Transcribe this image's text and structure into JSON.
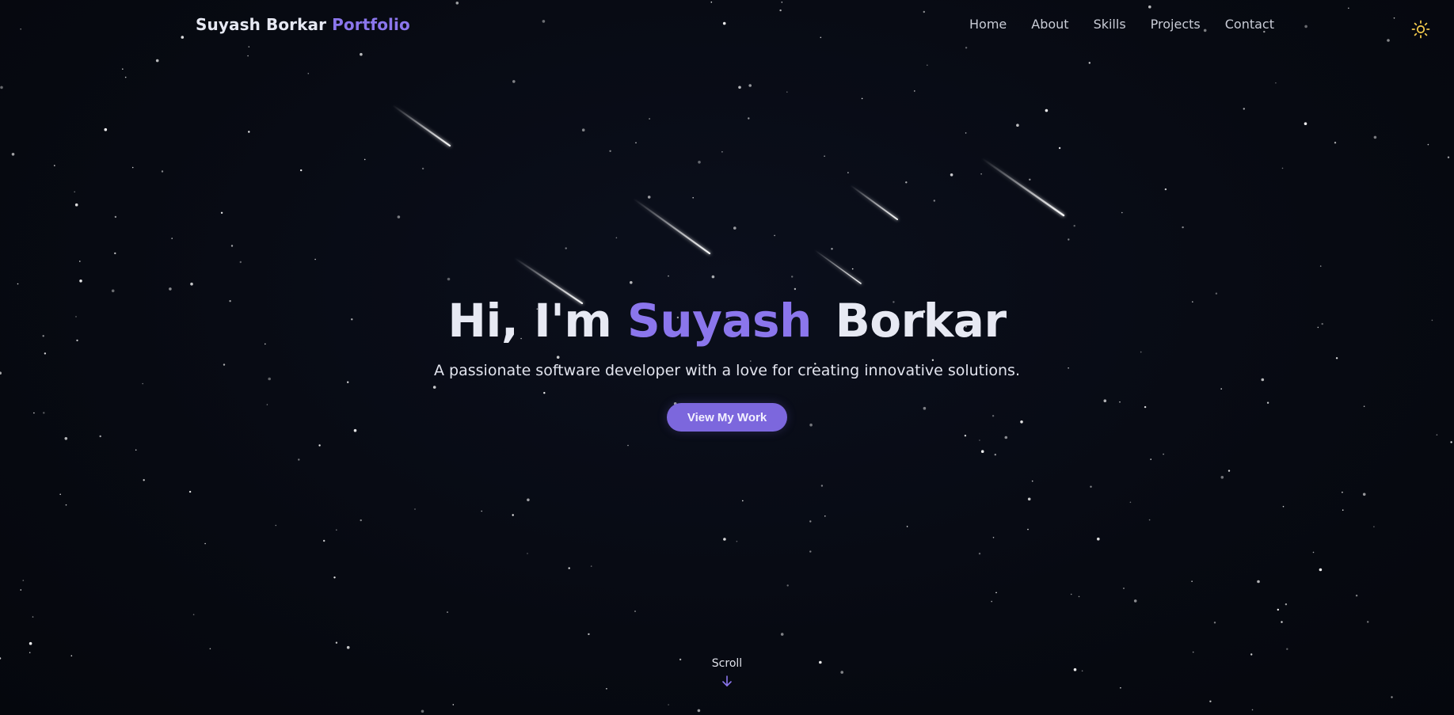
{
  "brand": {
    "name": "Suyash Borkar",
    "accent": "Portfolio"
  },
  "nav": {
    "items": [
      {
        "label": "Home"
      },
      {
        "label": "About"
      },
      {
        "label": "Skills"
      },
      {
        "label": "Projects"
      },
      {
        "label": "Contact"
      }
    ]
  },
  "theme_toggle": {
    "icon": "sun-icon"
  },
  "hero": {
    "greeting": "Hi, I'm",
    "first_name": "Suyash",
    "last_name": "Borkar",
    "tagline": "A passionate software developer with a love for creating innovative solutions.",
    "cta_label": "View My Work"
  },
  "scroll": {
    "label": "Scroll",
    "icon": "arrow-down-icon"
  },
  "colors": {
    "background": "#070a12",
    "accent": "#8b76ec",
    "button": "#7c67dd",
    "sun": "#f2c94c"
  }
}
